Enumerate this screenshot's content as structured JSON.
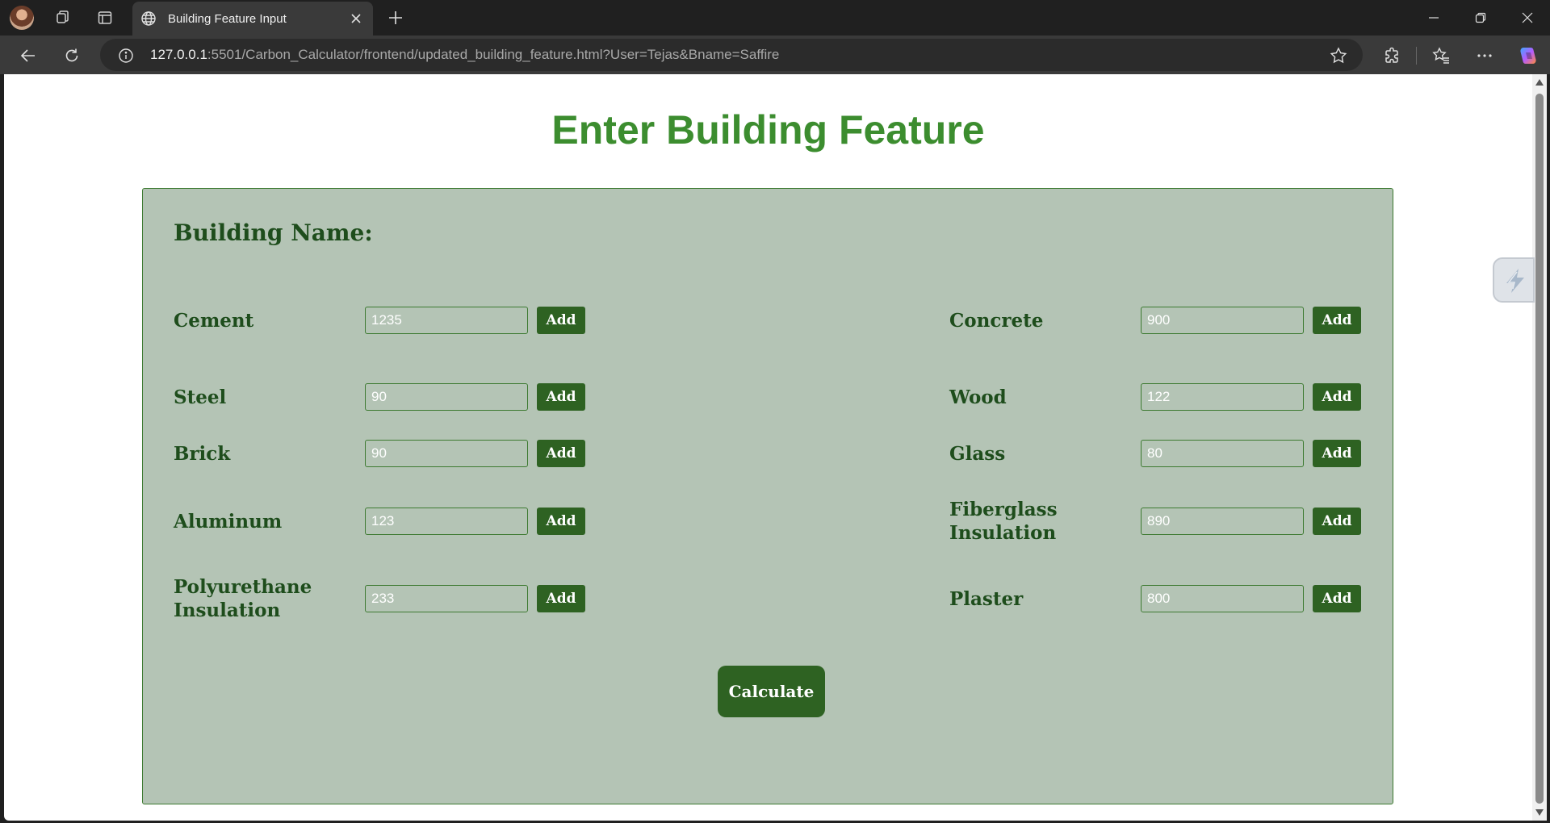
{
  "browser": {
    "tab_title": "Building Feature Input",
    "url_host": "127.0.0.1",
    "url_rest": ":5501/Carbon_Calculator/frontend/updated_building_feature.html?User=Tejas&Bname=Saffire"
  },
  "page": {
    "title": "Enter Building Feature",
    "building_name_label": "Building Name:",
    "add_label": "Add",
    "calculate_label": "Calculate",
    "materials_left": [
      {
        "label": "Cement",
        "value": "1235"
      },
      {
        "label": "Steel",
        "value": "90"
      },
      {
        "label": "Brick",
        "value": "90"
      },
      {
        "label": "Aluminum",
        "value": "123"
      },
      {
        "label": "Polyurethane Insulation",
        "value": "233"
      }
    ],
    "materials_right": [
      {
        "label": "Concrete",
        "value": "900"
      },
      {
        "label": "Wood",
        "value": "122"
      },
      {
        "label": "Glass",
        "value": "80"
      },
      {
        "label": "Fiberglass Insulation",
        "value": "890"
      },
      {
        "label": "Plaster",
        "value": "800"
      }
    ]
  },
  "colors": {
    "title_green": "#3c8d2f",
    "panel_bg": "#b4c4b5",
    "button_green": "#2e6222",
    "label_green": "#1e4d1c"
  }
}
